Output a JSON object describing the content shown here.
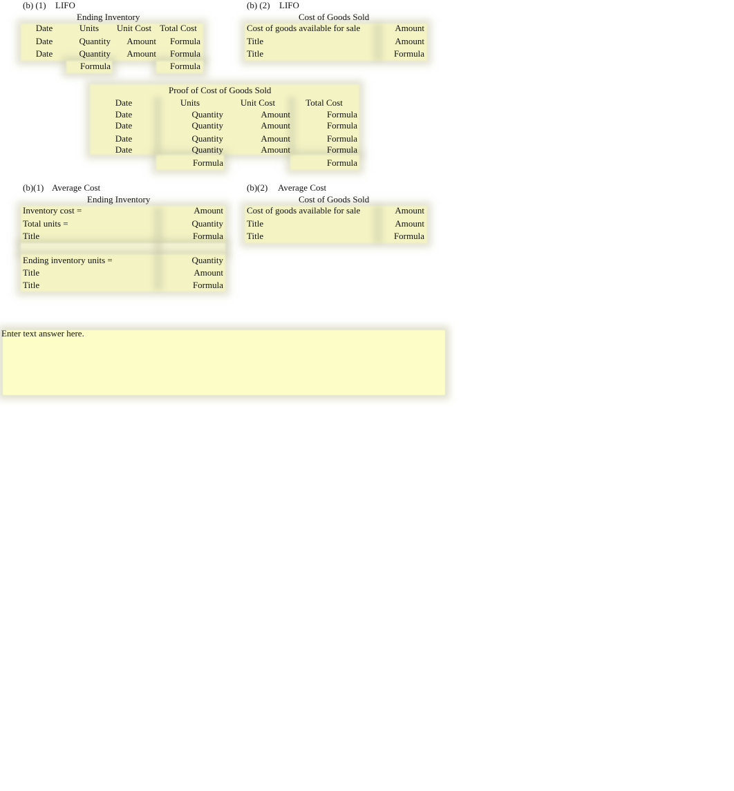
{
  "lifo": {
    "ending_inventory": {
      "section_label": "(b) (1)",
      "method": "LIFO",
      "title": "Ending Inventory",
      "headers": [
        "Date",
        "Units",
        "Unit Cost",
        "Total Cost"
      ],
      "rows": [
        [
          "Date",
          "Quantity",
          "Amount",
          "Formula"
        ],
        [
          "Date",
          "Quantity",
          "Amount",
          "Formula"
        ]
      ],
      "total_units": "Formula",
      "total_cost": "Formula"
    },
    "cogs": {
      "section_label": "(b) (2)",
      "method": "LIFO",
      "title": "Cost of Goods Sold",
      "rows": [
        [
          "Cost of goods available for sale",
          "Amount"
        ],
        [
          "Title",
          "Amount"
        ],
        [
          "Title",
          "Formula"
        ]
      ]
    },
    "proof": {
      "title": "Proof of Cost of Goods Sold",
      "headers": [
        "Date",
        "Units",
        "Unit Cost",
        "Total Cost"
      ],
      "rows": [
        [
          "Date",
          "Quantity",
          "Amount",
          "Formula"
        ],
        [
          "Date",
          "Quantity",
          "Amount",
          "Formula"
        ],
        [
          "Date",
          "Quantity",
          "Amount",
          "Formula"
        ],
        [
          "Date",
          "Quantity",
          "Amount",
          "Formula"
        ]
      ],
      "total_units": "Formula",
      "total_cost": "Formula"
    }
  },
  "average": {
    "ending_inventory": {
      "section_label": "(b)(1)",
      "method": "Average Cost",
      "title": "Ending Inventory",
      "rows": [
        [
          "Inventory cost =",
          "Amount"
        ],
        [
          "Total units =",
          "Quantity"
        ],
        [
          "Title",
          "Formula"
        ],
        [
          "",
          ""
        ],
        [
          "Ending inventory units =",
          "Quantity"
        ],
        [
          "Title",
          "Amount"
        ],
        [
          "Title",
          "Formula"
        ]
      ]
    },
    "cogs": {
      "section_label": "(b)(2)",
      "method": "Average Cost",
      "title": "Cost of Goods Sold",
      "rows": [
        [
          "Cost of goods available for sale",
          "Amount"
        ],
        [
          "Title",
          "Amount"
        ],
        [
          "Title",
          "Formula"
        ]
      ]
    }
  },
  "answer": {
    "placeholder": "Enter text answer here."
  }
}
